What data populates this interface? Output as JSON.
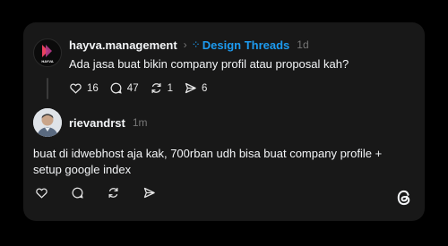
{
  "post": {
    "author": "hayva.management",
    "avatar_text": "HAYVA",
    "topic": "Design Threads",
    "time": "1d",
    "text": "Ada jasa buat bikin company profil atau proposal kah?",
    "likes": "16",
    "comments": "47",
    "reposts": "1",
    "shares": "6"
  },
  "reply": {
    "author": "rievandrst",
    "time": "1m",
    "text": "buat di idwebhost aja kak, 700rban udh bisa buat company profile + setup google index"
  },
  "colors": {
    "background": "#000000",
    "card": "#181818",
    "topic": "#1d9bf0",
    "brand_logo": "#e9415f"
  },
  "icons": [
    "heart-icon",
    "comment-icon",
    "repost-icon",
    "send-icon",
    "threads-logo-icon"
  ]
}
